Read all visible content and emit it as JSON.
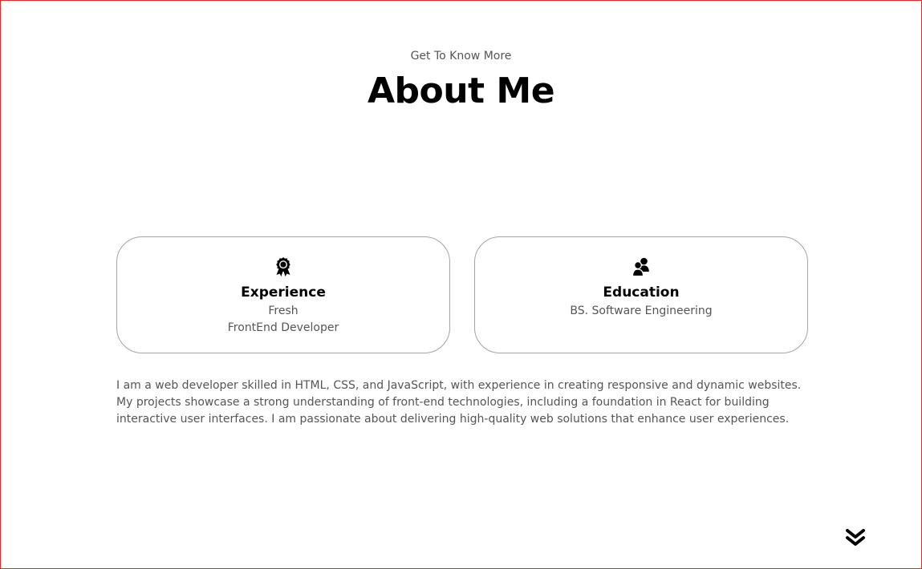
{
  "section": {
    "subtitle": "Get To Know More",
    "title": "About Me"
  },
  "cards": {
    "experience": {
      "icon": "award-ribbon-icon",
      "title": "Experience",
      "lines": [
        "Fresh",
        "FrontEnd Developer"
      ]
    },
    "education": {
      "icon": "users-icon",
      "title": "Education",
      "lines": [
        "BS. Software Engineering"
      ]
    }
  },
  "bio": "I am a web developer skilled in HTML, CSS, and JavaScript, with experience in creating responsive and dynamic websites. My projects showcase a strong understanding of front-end technologies, including a foundation in React for building interactive user interfaces. I am passionate about delivering high-quality web solutions that enhance user experiences.",
  "navigation": {
    "scroll_icon": "double-chevron-down-icon"
  },
  "colors": {
    "frame_border": "#d32f2f",
    "card_border": "#a3a3a3",
    "heading": "#000000",
    "body_text": "#555555"
  }
}
